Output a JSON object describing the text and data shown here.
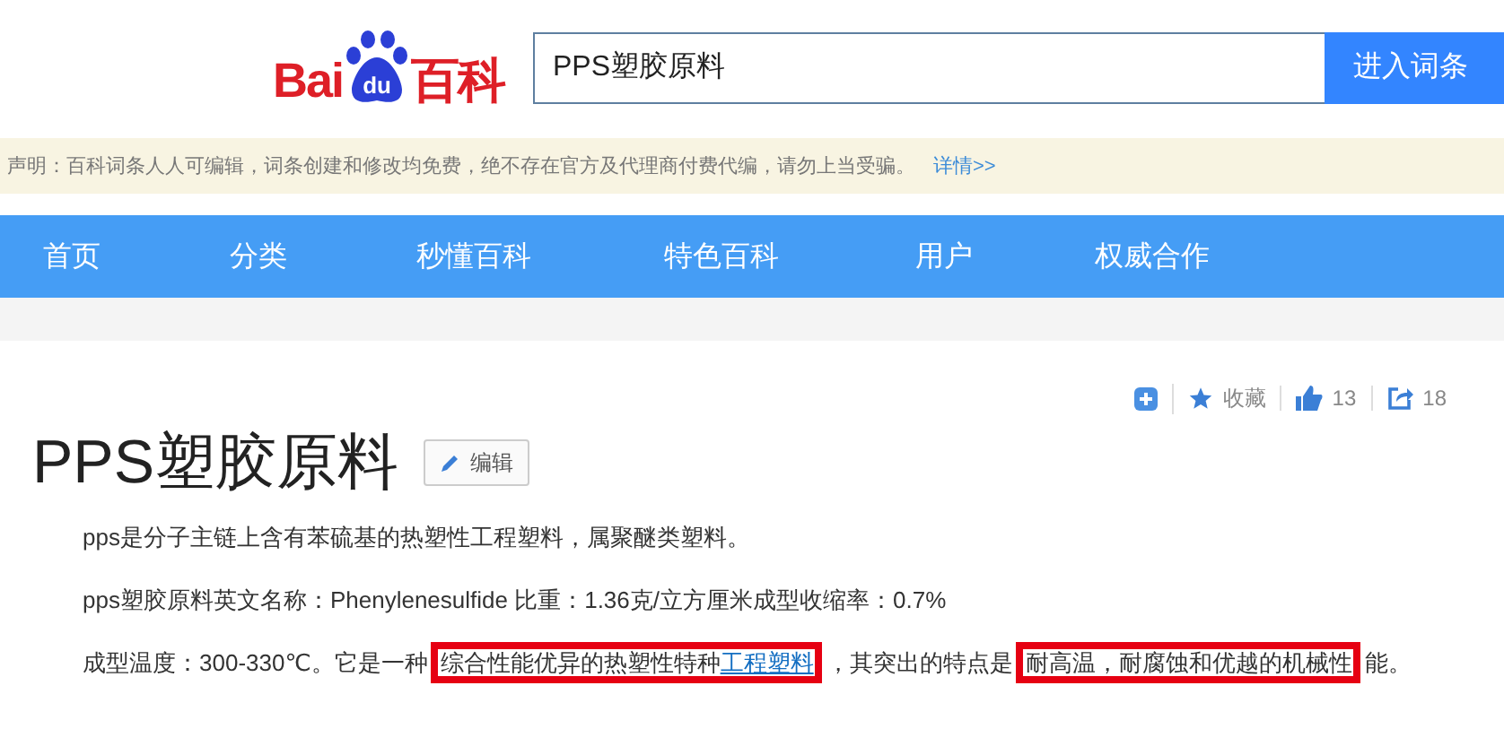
{
  "header": {
    "logo": {
      "left": "Bai",
      "paw": "du",
      "right": "百科"
    },
    "search": {
      "value": "PPS塑胶原料"
    },
    "search_button": "进入词条"
  },
  "notice": {
    "text": "声明：百科词条人人可编辑，词条创建和修改均免费，绝不存在官方及代理商付费代编，请勿上当受骗。",
    "link": "详情>>"
  },
  "nav": [
    {
      "label": "首页"
    },
    {
      "label": "分类"
    },
    {
      "label": "秒懂百科"
    },
    {
      "label": "特色百科"
    },
    {
      "label": "用户"
    },
    {
      "label": "权威合作"
    }
  ],
  "actions": {
    "favorite": "收藏",
    "likes": "13",
    "shares": "18"
  },
  "article": {
    "title": "PPS塑胶原料",
    "edit_button": "编辑",
    "paragraphs": [
      [
        {
          "text": "pps是分子主链上含有苯硫基的热塑性工程塑料，属聚醚类塑料。",
          "highlighted": false
        }
      ],
      [
        {
          "text": "pps塑胶原料英文名称：Phenylenesulfide 比重：1.36克/立方厘米成型收缩率：0.7%",
          "highlighted": false
        }
      ],
      [
        {
          "text": "成型温度：300-330℃。它是一种",
          "highlighted": false
        },
        {
          "text": "综合性能优异的热塑性特种",
          "highlighted": true,
          "link": "工程塑料"
        },
        {
          "text": "，其突出的特点是",
          "highlighted": false
        },
        {
          "text": "耐高温，耐腐蚀和优越的机械性",
          "highlighted": true
        },
        {
          "text": "能。",
          "highlighted": false
        }
      ]
    ]
  }
}
